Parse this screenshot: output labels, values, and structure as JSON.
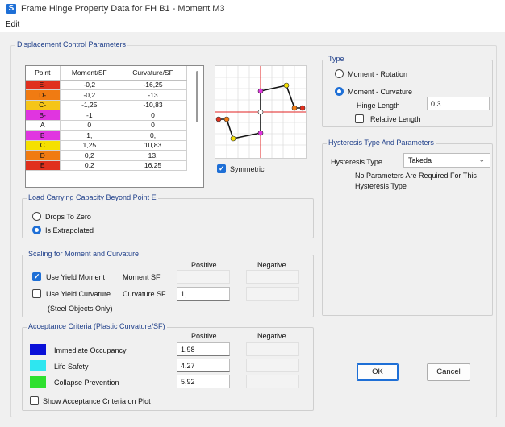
{
  "window": {
    "title": "Frame Hinge Property Data for FH B1 - Moment M3",
    "app_icon": "S"
  },
  "menu": {
    "edit": "Edit"
  },
  "displacement": {
    "legend": "Displacement Control Parameters",
    "columns": [
      "Point",
      "Moment/SF",
      "Curvature/SF"
    ],
    "rows": [
      {
        "point": "E-",
        "moment": "-0,2",
        "curvature": "-16,25",
        "color": "#e0301e"
      },
      {
        "point": "D-",
        "moment": "-0,2",
        "curvature": "-13",
        "color": "#f07b12"
      },
      {
        "point": "C-",
        "moment": "-1,25",
        "curvature": "-10,83",
        "color": "#f5c518"
      },
      {
        "point": "B-",
        "moment": "-1",
        "curvature": "0",
        "color": "#e035e0"
      },
      {
        "point": "A",
        "moment": "0",
        "curvature": "0",
        "color": "#ffffff"
      },
      {
        "point": "B",
        "moment": "1,",
        "curvature": "0,",
        "color": "#e035e0"
      },
      {
        "point": "C",
        "moment": "1,25",
        "curvature": "10,83",
        "color": "#f5e000"
      },
      {
        "point": "D",
        "moment": "0,2",
        "curvature": "13,",
        "color": "#f07b12"
      },
      {
        "point": "E",
        "moment": "0,2",
        "curvature": "16,25",
        "color": "#e0301e"
      }
    ],
    "symmetric_label": "Symmetric",
    "symmetric_checked": true
  },
  "type": {
    "legend": "Type",
    "option_rotation": "Moment - Rotation",
    "option_curvature": "Moment - Curvature",
    "selected": "curvature",
    "hinge_length_label": "Hinge Length",
    "hinge_length_value": "0,3",
    "relative_length_label": "Relative Length",
    "relative_length_checked": false
  },
  "hysteresis": {
    "legend": "Hysteresis Type And Parameters",
    "type_label": "Hysteresis Type",
    "type_value": "Takeda",
    "note_line1": "No Parameters Are Required For This",
    "note_line2": "Hysteresis Type"
  },
  "load_capacity": {
    "legend": "Load Carrying Capacity Beyond Point E",
    "option_zero": "Drops To Zero",
    "option_extrapolated": "Is Extrapolated",
    "selected": "extrapolated"
  },
  "scaling": {
    "legend": "Scaling for Moment and Curvature",
    "positive_header": "Positive",
    "negative_header": "Negative",
    "use_yield_moment_label": "Use Yield Moment",
    "use_yield_moment_checked": true,
    "moment_sf_label": "Moment SF",
    "moment_sf_positive": "",
    "moment_sf_negative": "",
    "use_yield_curvature_label": "Use Yield Curvature",
    "use_yield_curvature_checked": false,
    "curvature_sf_label": "Curvature SF",
    "curvature_sf_positive": "1,",
    "curvature_sf_negative": "",
    "steel_note": "(Steel Objects Only)"
  },
  "acceptance": {
    "legend": "Acceptance Criteria (Plastic Curvature/SF)",
    "positive_header": "Positive",
    "negative_header": "Negative",
    "items": [
      {
        "label": "Immediate Occupancy",
        "positive": "1,98",
        "negative": "",
        "color": "#0a10d8"
      },
      {
        "label": "Life Safety",
        "positive": "4,27",
        "negative": "",
        "color": "#2ee6f0"
      },
      {
        "label": "Collapse Prevention",
        "positive": "5,92",
        "negative": "",
        "color": "#2ee02e"
      }
    ],
    "show_on_plot_label": "Show Acceptance Criteria on Plot",
    "show_on_plot_checked": false
  },
  "buttons": {
    "ok": "OK",
    "cancel": "Cancel"
  }
}
